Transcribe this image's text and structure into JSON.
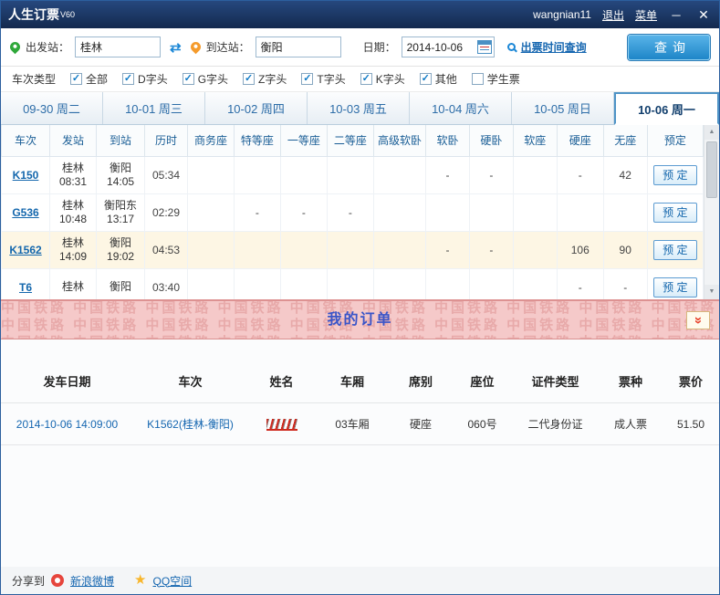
{
  "window": {
    "title": "人生订票",
    "version": "V60",
    "username": "wangnian11",
    "logout_label": "退出",
    "menu_label": "菜单"
  },
  "search": {
    "from_label": "出发站：",
    "from_value": "桂林",
    "to_label": "到达站：",
    "to_value": "衡阳",
    "date_label": "日期：",
    "date_value": "2014-10-06",
    "ticket_time_link": "出票时间查询",
    "query_button": "查询"
  },
  "filters": {
    "label": "车次类型",
    "options": [
      {
        "label": "全部",
        "checked": true
      },
      {
        "label": "D字头",
        "checked": true
      },
      {
        "label": "G字头",
        "checked": true
      },
      {
        "label": "Z字头",
        "checked": true
      },
      {
        "label": "T字头",
        "checked": true
      },
      {
        "label": "K字头",
        "checked": true
      },
      {
        "label": "其他",
        "checked": true
      },
      {
        "label": "学生票",
        "checked": false
      }
    ]
  },
  "date_tabs": [
    {
      "label": "09-30 周二",
      "active": false
    },
    {
      "label": "10-01 周三",
      "active": false
    },
    {
      "label": "10-02 周四",
      "active": false
    },
    {
      "label": "10-03 周五",
      "active": false
    },
    {
      "label": "10-04 周六",
      "active": false
    },
    {
      "label": "10-05 周日",
      "active": false
    },
    {
      "label": "10-06 周一",
      "active": true
    }
  ],
  "train_table": {
    "headers": [
      "车次",
      "发站",
      "到站",
      "历时",
      "商务座",
      "特等座",
      "一等座",
      "二等座",
      "高级软卧",
      "软卧",
      "硬卧",
      "软座",
      "硬座",
      "无座",
      "预定"
    ],
    "book_label": "预 定",
    "rows": [
      {
        "train": "K150",
        "from_station": "桂林",
        "from_time": "08:31",
        "to_station": "衡阳",
        "to_time": "14:05",
        "duration": "05:34",
        "seats": [
          "",
          "",
          "",
          "",
          "",
          "-",
          "-",
          "",
          "-",
          "42"
        ],
        "highlight": false
      },
      {
        "train": "G536",
        "from_station": "桂林",
        "from_time": "10:48",
        "to_station": "衡阳东",
        "to_time": "13:17",
        "duration": "02:29",
        "seats": [
          "",
          "-",
          "-",
          "-",
          "",
          "",
          "",
          "",
          "",
          ""
        ],
        "highlight": false
      },
      {
        "train": "K1562",
        "from_station": "桂林",
        "from_time": "14:09",
        "to_station": "衡阳",
        "to_time": "19:02",
        "duration": "04:53",
        "seats": [
          "",
          "",
          "",
          "",
          "",
          "-",
          "-",
          "",
          "106",
          "90"
        ],
        "highlight": true
      },
      {
        "train": "T6",
        "from_station": "桂林",
        "from_time": "",
        "to_station": "衡阳",
        "to_time": "",
        "duration": "03:40",
        "seats": [
          "",
          "",
          "",
          "",
          "",
          "",
          "",
          "",
          "-",
          "-"
        ],
        "highlight": false
      }
    ]
  },
  "orders": {
    "title": "我的订单",
    "watermark_text": "中国铁路",
    "headers": [
      "发车日期",
      "车次",
      "姓名",
      "车厢",
      "席别",
      "座位",
      "证件类型",
      "票种",
      "票价"
    ],
    "rows": [
      {
        "depart_time": "2014-10-06 14:09:00",
        "train": "K1562(桂林-衡阳)",
        "name_redacted": true,
        "carriage": "03车厢",
        "seat_class": "硬座",
        "seat_no": "060号",
        "id_type": "二代身份证",
        "ticket_type": "成人票",
        "price": "51.50"
      }
    ]
  },
  "footer": {
    "share_label": "分享到",
    "weibo_label": "新浪微博",
    "qzone_label": "QQ空间"
  }
}
